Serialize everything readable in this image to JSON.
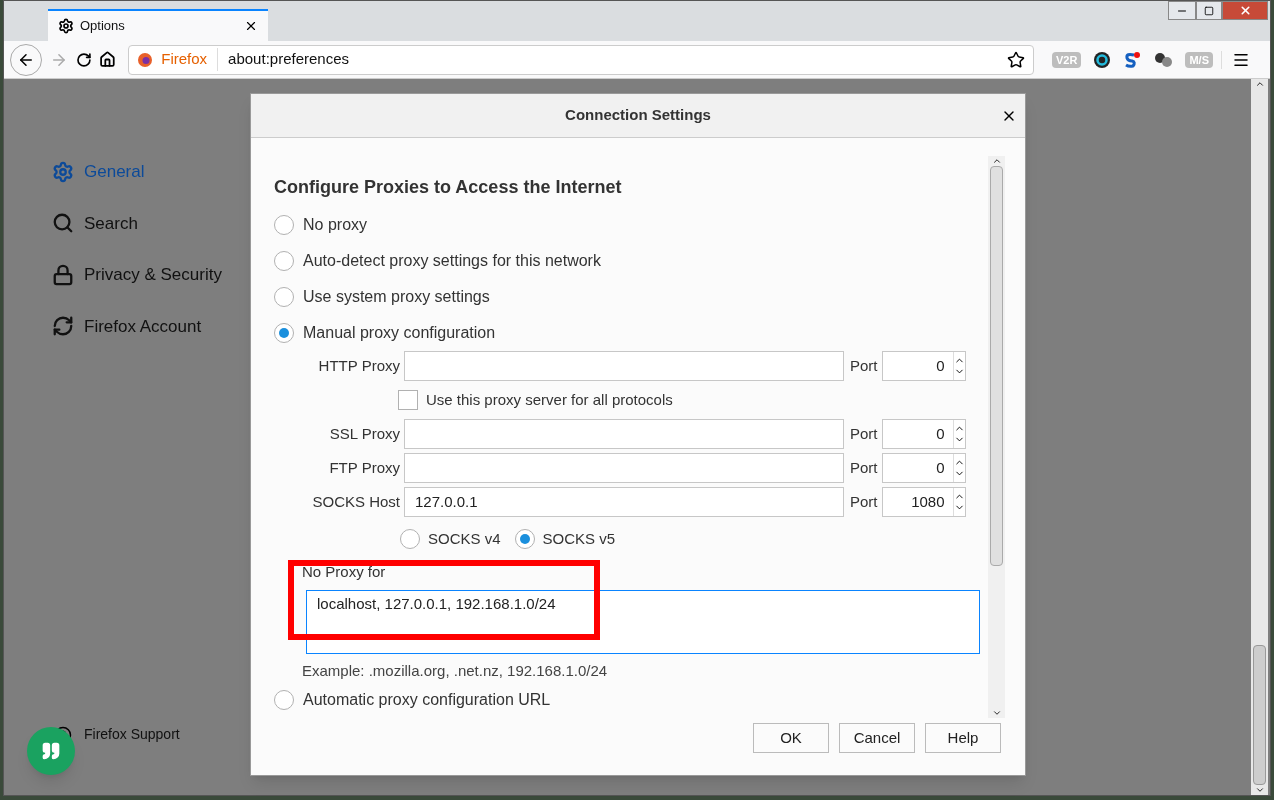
{
  "window": {
    "tab_title": "Options",
    "identity": "Firefox",
    "url": "about:preferences"
  },
  "extensions": [
    {
      "kind": "badge",
      "label": "V2R"
    },
    {
      "kind": "dial"
    },
    {
      "kind": "s-mark"
    },
    {
      "kind": "balls"
    },
    {
      "kind": "badge",
      "label": "M/S"
    }
  ],
  "sidebar": {
    "items": [
      {
        "kind": "gear",
        "label": "General",
        "selected": true
      },
      {
        "kind": "search",
        "label": "Search",
        "selected": false
      },
      {
        "kind": "lock",
        "label": "Privacy & Security",
        "selected": false
      },
      {
        "kind": "sync",
        "label": "Firefox Account",
        "selected": false
      }
    ],
    "support": "Firefox Support"
  },
  "dialog": {
    "title": "Connection Settings",
    "heading": "Configure Proxies to Access the Internet",
    "modes": [
      {
        "kind": "none",
        "label": "No proxy",
        "selected": false
      },
      {
        "kind": "auto",
        "label": "Auto-detect proxy settings for this network",
        "selected": false
      },
      {
        "kind": "system",
        "label": "Use system proxy settings",
        "selected": false
      },
      {
        "kind": "manual",
        "label": "Manual proxy configuration",
        "selected": true
      },
      {
        "kind": "pac",
        "label": "Automatic proxy configuration URL",
        "selected": false
      }
    ],
    "manual": {
      "proxies": [
        {
          "label": "HTTP Proxy",
          "port_label": "Port",
          "port": "0"
        },
        {
          "label": "SSL Proxy",
          "port_label": "Port",
          "port": "0"
        },
        {
          "label": "FTP Proxy",
          "port_label": "Port",
          "port": "0"
        },
        {
          "label": "SOCKS Host",
          "value": "127.0.0.1",
          "port_label": "Port",
          "port": "1080"
        }
      ],
      "share": {
        "label": "Use this proxy server for all protocols",
        "checked": false
      },
      "socks_versions": [
        {
          "label": "SOCKS v4",
          "selected": false
        },
        {
          "label": "SOCKS v5",
          "selected": true
        }
      ],
      "no_proxy": {
        "label": "No Proxy for",
        "value": "localhost, 127.0.0.1, 192.168.1.0/24"
      },
      "example": "Example: .mozilla.org, .net.nz, 192.168.1.0/24"
    },
    "buttons": [
      "OK",
      "Cancel",
      "Help"
    ]
  }
}
